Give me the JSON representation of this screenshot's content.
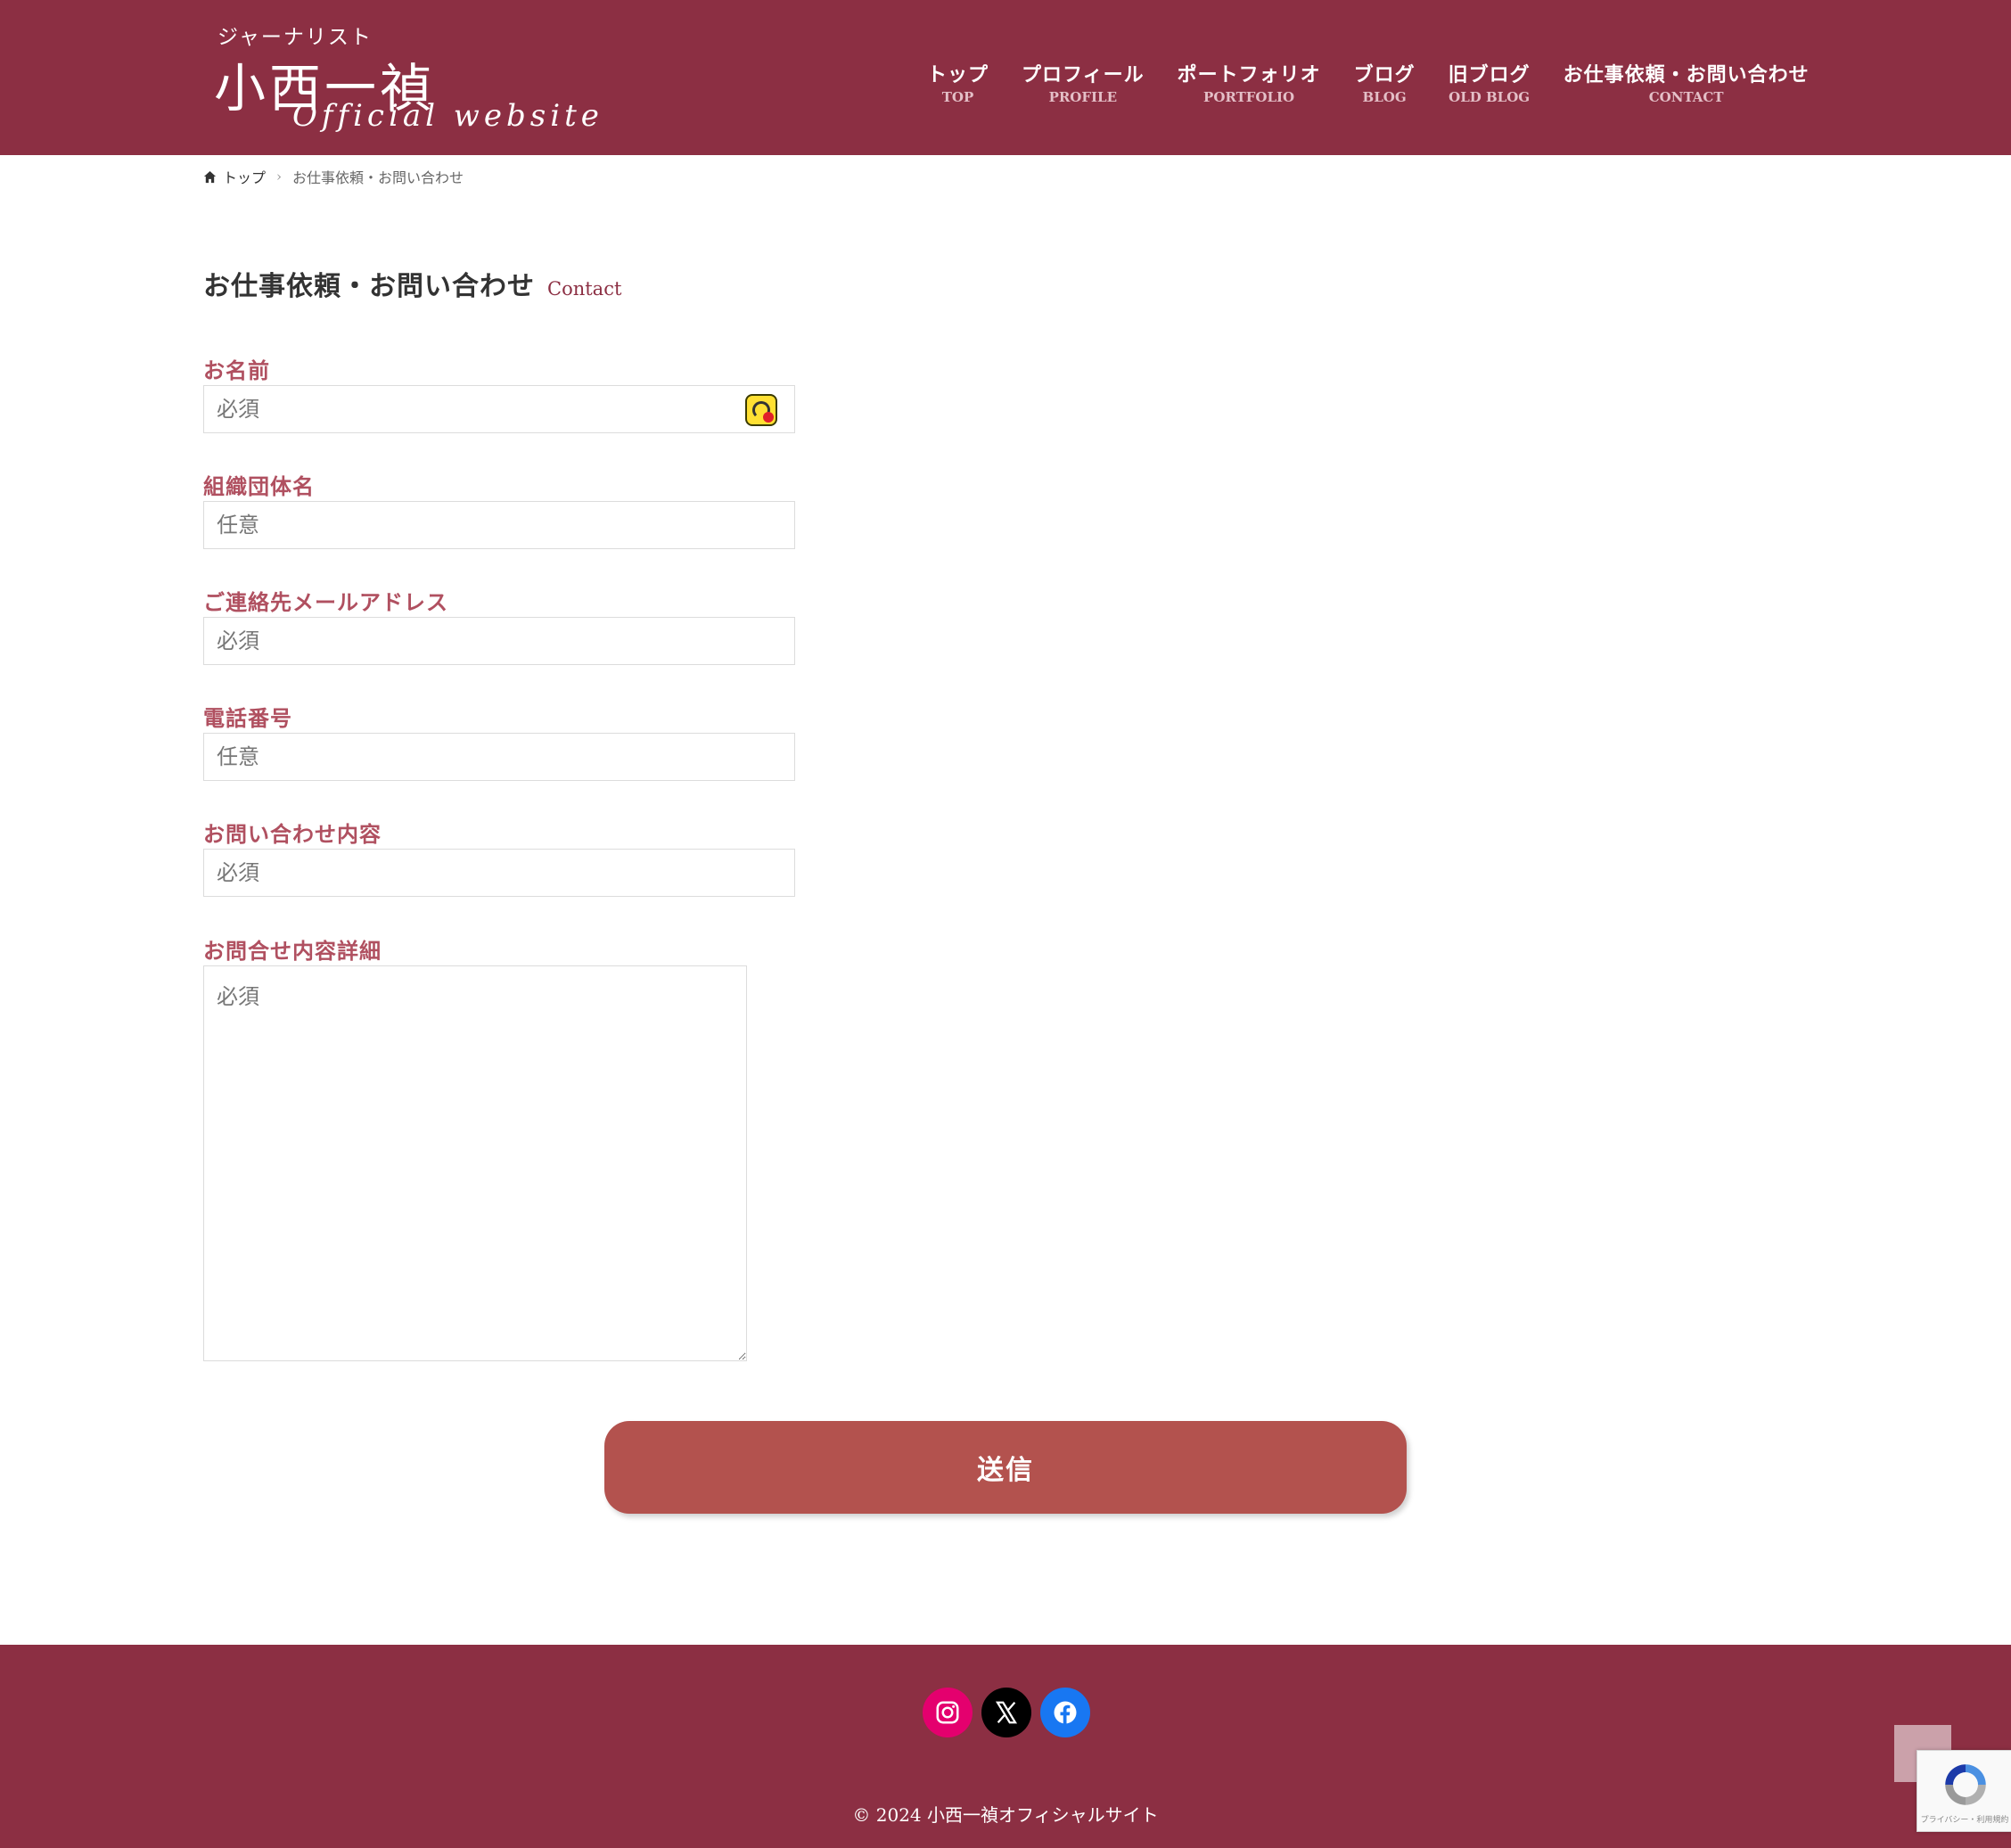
{
  "header": {
    "logo_sub": "ジャーナリスト",
    "logo_main": "小西一禎",
    "logo_en": "Official website",
    "nav": [
      {
        "ja": "トップ",
        "en": "TOP"
      },
      {
        "ja": "プロフィール",
        "en": "PROFILE"
      },
      {
        "ja": "ポートフォリオ",
        "en": "PORTFOLIO"
      },
      {
        "ja": "ブログ",
        "en": "BLOG"
      },
      {
        "ja": "旧ブログ",
        "en": "OLD BLOG"
      },
      {
        "ja": "お仕事依頼・お問い合わせ",
        "en": "CONTACT"
      }
    ]
  },
  "breadcrumb": {
    "home": "トップ",
    "current": "お仕事依頼・お問い合わせ"
  },
  "page": {
    "title": "お仕事依頼・お問い合わせ",
    "title_en": "Contact"
  },
  "form": {
    "fields": [
      {
        "label": "お名前",
        "placeholder": "必須"
      },
      {
        "label": "組織団体名",
        "placeholder": "任意"
      },
      {
        "label": "ご連絡先メールアドレス",
        "placeholder": "必須"
      },
      {
        "label": "電話番号",
        "placeholder": "任意"
      },
      {
        "label": "お問い合わせ内容",
        "placeholder": "必須"
      },
      {
        "label": "お問合せ内容詳細",
        "placeholder": "必須"
      }
    ],
    "submit": "送信"
  },
  "footer": {
    "copyright": "© 2024 小西一禎オフィシャルサイト",
    "social": [
      "instagram-icon",
      "x-icon",
      "facebook-icon"
    ]
  },
  "recaptcha": {
    "text": "プライバシー・利用規約"
  },
  "colors": {
    "brand": "#8c2f43",
    "label": "#b05060",
    "button": "#b3524e"
  }
}
